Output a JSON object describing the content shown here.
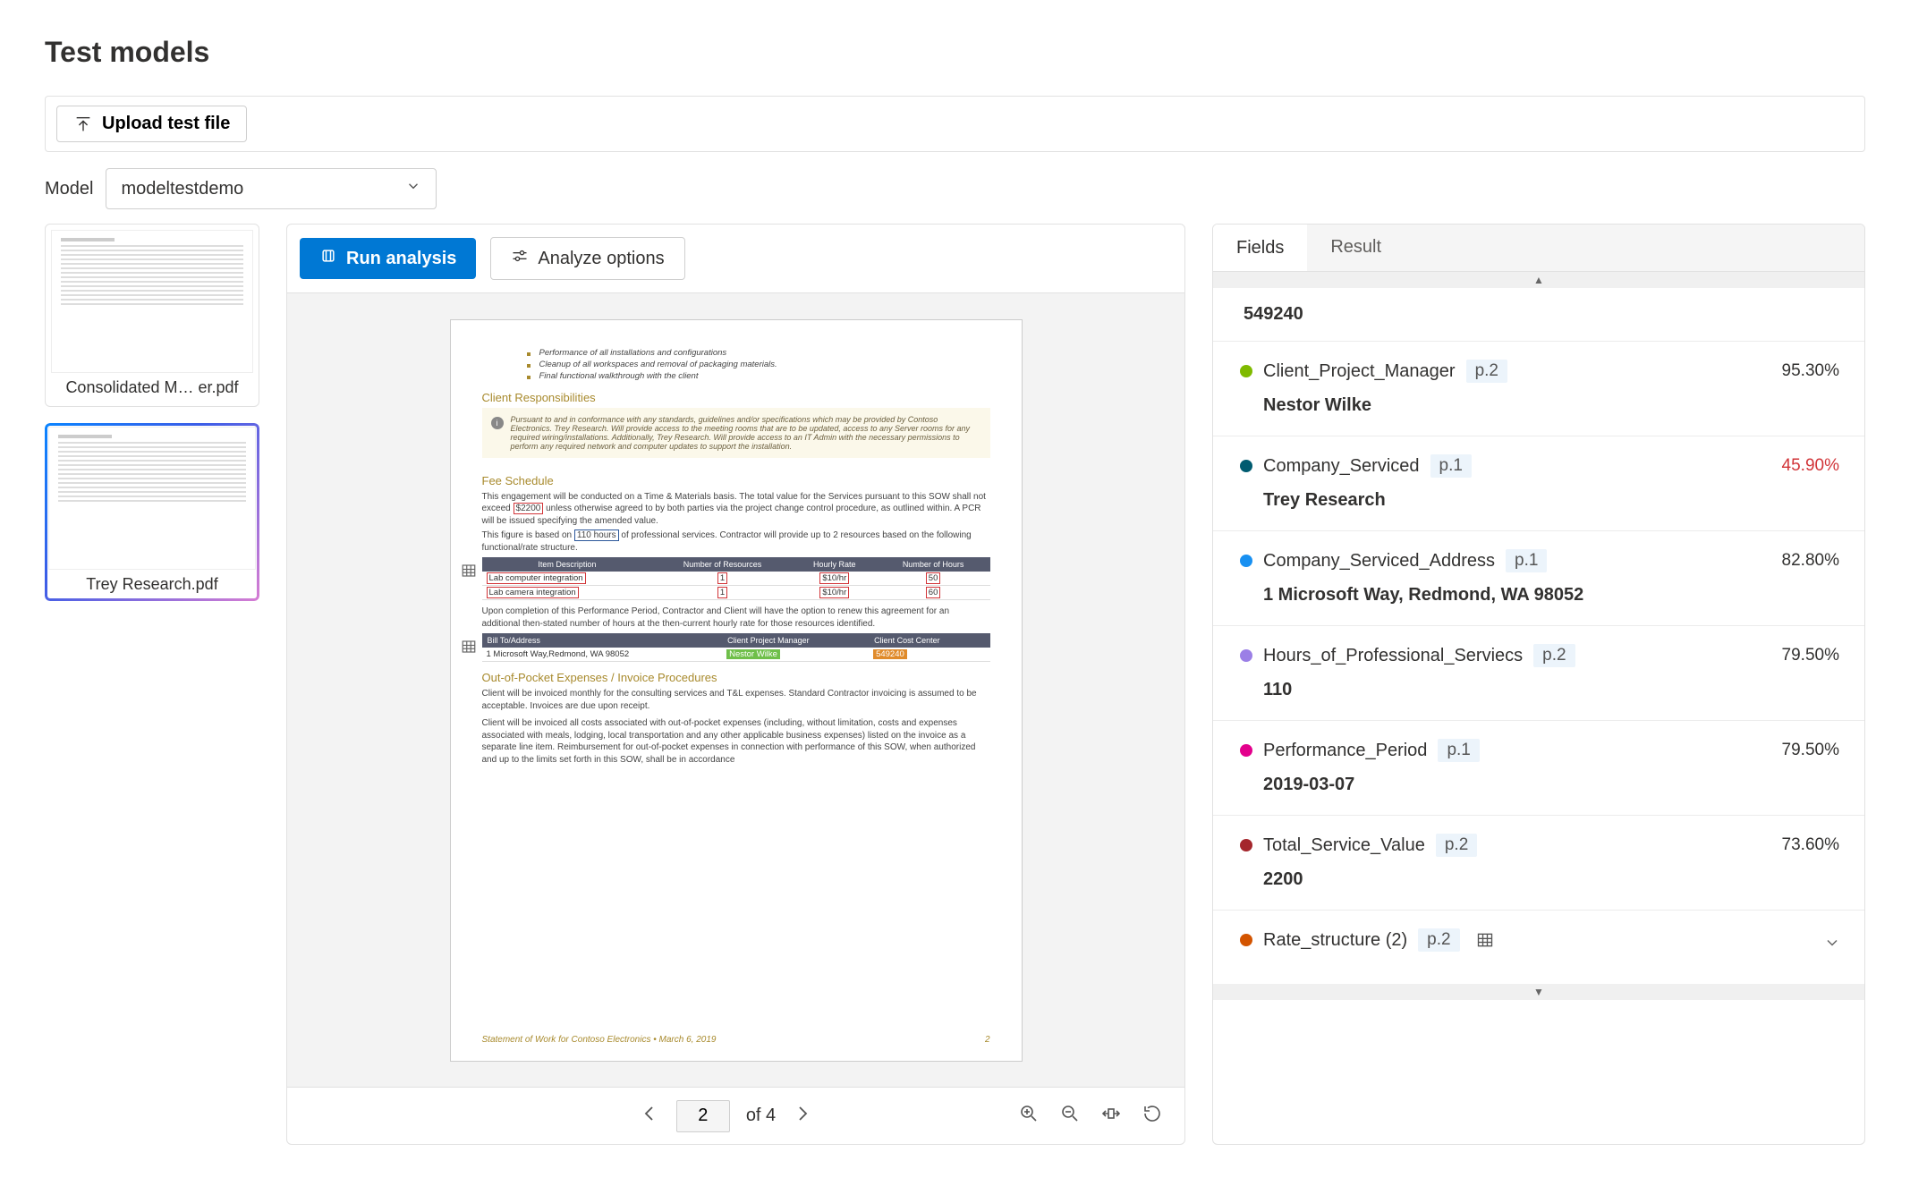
{
  "page_title": "Test models",
  "toolbar": {
    "upload_label": "Upload test file"
  },
  "model_label": "Model",
  "model_value": "modeltestdemo",
  "viewer": {
    "run_label": "Run analysis",
    "options_label": "Analyze options",
    "current_page": "2",
    "page_of": "of 4",
    "doc": {
      "bullets": [
        "Performance of all installations and configurations",
        "Cleanup of all workspaces and removal of packaging materials.",
        "Final functional walkthrough with the client"
      ],
      "sec_client": "Client Responsibilities",
      "client_note": "Pursuant to and in conformance with any standards, guidelines and/or specifications which may be provided by Contoso Electronics. Trey Research. Will provide access to the meeting rooms that are to be updated, access to any Server rooms for any required wiring/installations. Additionally, Trey Research. Will provide access to an IT Admin with the necessary permissions to perform any required network and computer updates to support the installation.",
      "sec_fee": "Fee Schedule",
      "fee_p1a": "This engagement will be conducted on a Time & Materials basis. The total value for the Services pursuant to this SOW shall not exceed ",
      "fee_total": "$2200",
      "fee_p1b": " unless otherwise agreed to by both parties via the project change control procedure, as outlined within. A PCR will be issued specifying the amended value.",
      "fee_p2a": "This figure is based on ",
      "fee_hours": "110 hours",
      "fee_p2b": " of professional services. Contractor will provide up to 2 resources based on the following functional/rate structure.",
      "rate_headers": [
        "Item Description",
        "Number of Resources",
        "Hourly Rate",
        "Number of Hours"
      ],
      "rate_rows": [
        [
          "Lab computer integration",
          "1",
          "$10/hr",
          "50"
        ],
        [
          "Lab camera integration",
          "1",
          "$10/hr",
          "60"
        ]
      ],
      "fee_p3": "Upon completion of this Performance Period, Contractor and Client will have the option to renew this agreement for an additional then-stated number of hours at the then-current hourly rate for those resources identified.",
      "bill_headers": [
        "Bill To/Address",
        "Client Project Manager",
        "Client Cost Center"
      ],
      "bill_addr": "1 Microsoft Way,Redmond, WA 98052",
      "bill_pm": "Nestor Wilke",
      "bill_cost": "549240",
      "sec_oop": "Out-of-Pocket Expenses / Invoice Procedures",
      "oop_p1": "Client will be invoiced monthly for the consulting services and T&L expenses. Standard Contractor invoicing is assumed to be acceptable. Invoices are due upon receipt.",
      "oop_p2": "Client will be invoiced all costs associated with out-of-pocket expenses (including, without limitation, costs and expenses associated with meals, lodging, local transportation and any other applicable business expenses) listed on the invoice as a separate line item. Reimbursement for out-of-pocket expenses in connection with performance of this SOW, when authorized and up to the limits set forth in this SOW, shall be in accordance",
      "footer_left": "Statement of Work for Contoso Electronics • March 6, 2019",
      "footer_right": "2"
    }
  },
  "thumbs": [
    {
      "name": "Consolidated M…  er.pdf",
      "selected": false
    },
    {
      "name": "Trey Research.pdf",
      "selected": true
    }
  ],
  "tabs": {
    "fields": "Fields",
    "result": "Result"
  },
  "top_value": "549240",
  "fields": [
    {
      "color": "#7fba00",
      "name": "Client_Project_Manager",
      "page": "p.2",
      "conf": "95.30%",
      "low": false,
      "value": "Nestor Wilke"
    },
    {
      "color": "#005b70",
      "name": "Company_Serviced",
      "page": "p.1",
      "conf": "45.90%",
      "low": true,
      "value": "Trey Research"
    },
    {
      "color": "#1890f1",
      "name": "Company_Serviced_Address",
      "page": "p.1",
      "conf": "82.80%",
      "low": false,
      "value": "1 Microsoft Way, Redmond, WA 98052"
    },
    {
      "color": "#9b7fe6",
      "name": "Hours_of_Professional_Serviecs",
      "page": "p.2",
      "conf": "79.50%",
      "low": false,
      "value": "110"
    },
    {
      "color": "#e3008c",
      "name": "Performance_Period",
      "page": "p.1",
      "conf": "79.50%",
      "low": false,
      "value": "2019-03-07"
    },
    {
      "color": "#a4262c",
      "name": "Total_Service_Value",
      "page": "p.2",
      "conf": "73.60%",
      "low": false,
      "value": "2200"
    }
  ],
  "rate_field": {
    "color": "#d35400",
    "name": "Rate_structure (2)",
    "page": "p.2"
  }
}
